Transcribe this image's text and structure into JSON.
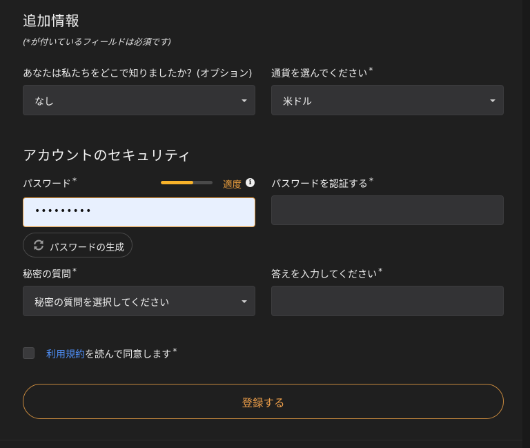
{
  "sections": {
    "additional_info_title": "追加情報",
    "required_note": "(*が付いているフィールドは必須です)",
    "security_title": "アカウントのセキュリティ"
  },
  "fields": {
    "referral": {
      "label": "あなたは私たちをどこで知りましたか？(オプション)",
      "value": "なし"
    },
    "currency": {
      "label": "通貨を選んでください",
      "required_mark": "*",
      "value": "米ドル"
    },
    "password": {
      "label": "パスワード",
      "required_mark": "*",
      "value": "•••••••••",
      "strength_label": "適度",
      "strength_level": 0.62,
      "strength_color": "#f7b22a"
    },
    "confirm_password": {
      "label": "パスワードを認証する",
      "required_mark": "*",
      "value": ""
    },
    "generate_password": {
      "label": "パスワードの生成",
      "icon": "refresh-icon"
    },
    "security_question": {
      "label": "秘密の質問",
      "required_mark": "*",
      "value": "秘密の質問を選択してください"
    },
    "answer": {
      "label": "答えを入力してください",
      "required_mark": "*",
      "value": ""
    }
  },
  "terms": {
    "link_text": "利用規約",
    "text": "を読んで同意します",
    "required_mark": "*",
    "checked": false
  },
  "submit": {
    "label": "登録する"
  },
  "colors": {
    "background": "#1f1f1f",
    "field": "#333335",
    "accent": "#e89c3c",
    "link": "#4f8ff7",
    "autofill": "#e8f0fe"
  }
}
